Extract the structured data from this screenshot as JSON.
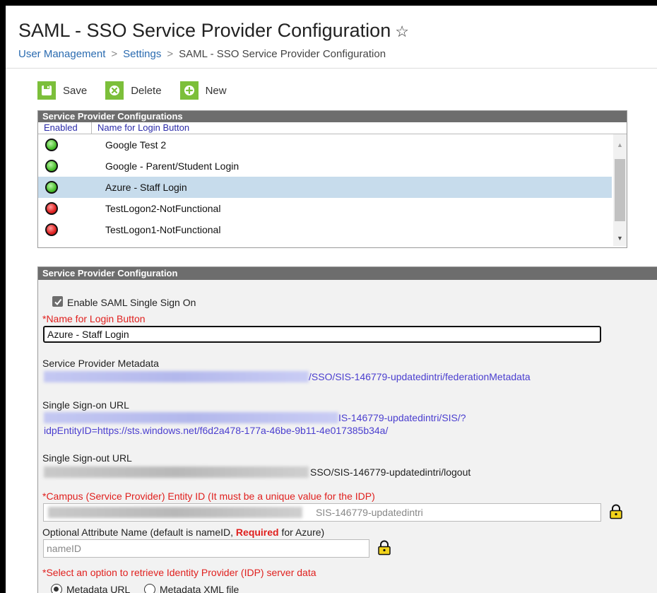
{
  "header": {
    "title": "SAML - SSO Service Provider Configuration",
    "star_glyph": "☆",
    "breadcrumb": [
      "User Management",
      "Settings",
      "SAML - SSO Service Provider Configuration"
    ],
    "breadcrumb_sep": ">"
  },
  "toolbar": {
    "save_label": "Save",
    "delete_label": "Delete",
    "new_label": "New"
  },
  "list_panel": {
    "title": "Service Provider Configurations",
    "col_enabled": "Enabled",
    "col_name": "Name for Login Button",
    "rows": [
      {
        "enabled": true,
        "name": "Google Test 2"
      },
      {
        "enabled": true,
        "name": "Google - Parent/Student Login"
      },
      {
        "enabled": true,
        "name": "Azure - Staff Login",
        "selected": true
      },
      {
        "enabled": false,
        "name": "TestLogon2-NotFunctional"
      },
      {
        "enabled": false,
        "name": "TestLogon1-NotFunctional"
      }
    ]
  },
  "detail_panel": {
    "title": "Service Provider Configuration",
    "enable_saml_label": "Enable SAML Single Sign On",
    "enable_saml_checked": true,
    "name_label": "*Name for Login Button",
    "name_value": "Azure - Staff Login",
    "sp_metadata_label": "Service Provider Metadata",
    "sp_metadata_url": "/SSO/SIS-146779-updatedintri/federationMetadata",
    "sso_url_label": "Single Sign-on URL",
    "sso_url_line1": "IS-146779-updatedintri/SIS/?",
    "sso_url_line2": "idpEntityID=https://sts.windows.net/f6d2a478-177a-46be-9b11-4e017385b34a/",
    "slo_url_label": "Single Sign-out URL",
    "slo_url": "SSO/SIS-146779-updatedintri/logout",
    "entity_id_label": "*Campus (Service Provider) Entity ID (It must be a unique value for the IDP)",
    "entity_id_value": "SIS-146779-updatedintri",
    "attr_label_part1": "Optional Attribute Name (default is nameID, ",
    "attr_label_required": "Required",
    "attr_label_part2": " for Azure)",
    "attr_value": "nameID",
    "idp_option_label": "*Select an option to retrieve Identity Provider (IDP) server data",
    "idp_option_metadata_url": "Metadata URL",
    "idp_option_metadata_file": "Metadata XML file"
  },
  "colors": {
    "accent_green": "#7cbf3a",
    "panel_header": "#6d6d6d",
    "selected_row": "#c7dcec",
    "required_red": "#e0201e",
    "link_blue": "#4a3ecf"
  }
}
